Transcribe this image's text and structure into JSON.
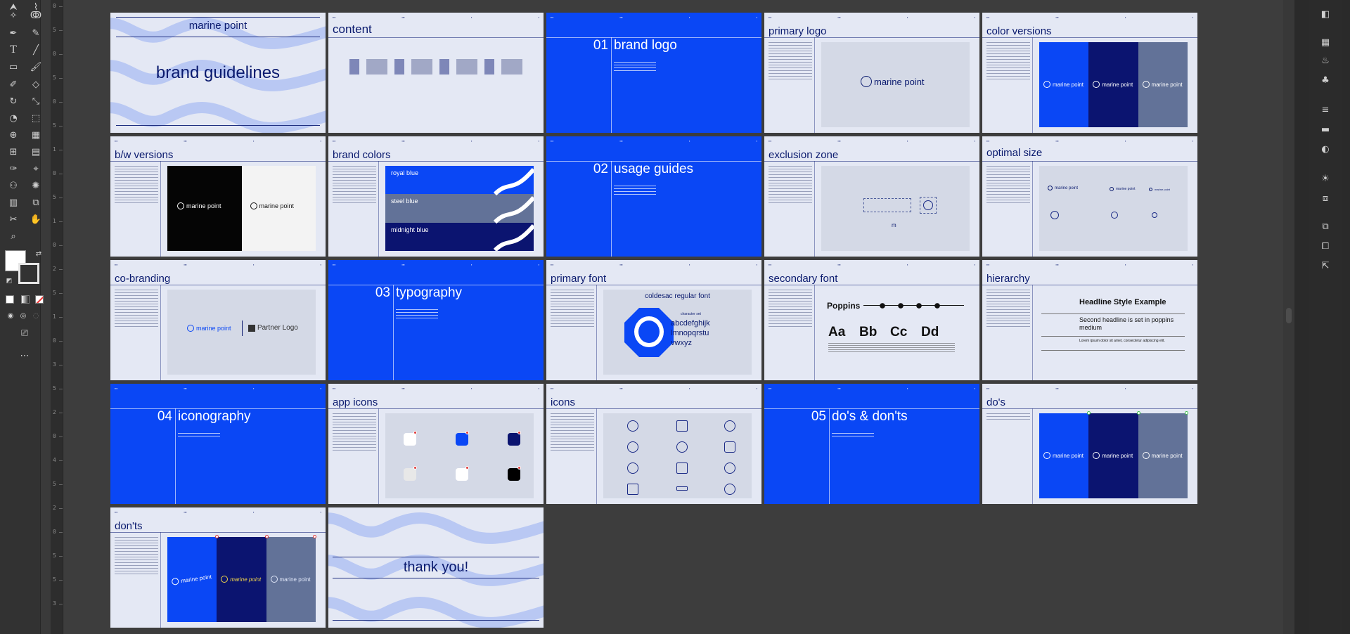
{
  "app": {
    "name": "Adobe Illustrator"
  },
  "tools": [
    "direct-selection",
    "lasso",
    "pen",
    "curvature",
    "type",
    "line",
    "rectangle",
    "paintbrush",
    "shaper",
    "eraser",
    "rotate",
    "scale",
    "warp",
    "free-transform",
    "shape-builder",
    "perspective-grid",
    "mesh",
    "gradient",
    "eyedropper",
    "blend",
    "symbol-sprayer",
    "column-graph",
    "artboard",
    "slice",
    "hand",
    "zoom"
  ],
  "ruler_labels": [
    "0",
    "5",
    "0",
    "5",
    "0",
    "5",
    "1",
    "0",
    "5",
    "1",
    "0",
    "2",
    "5",
    "1",
    "0",
    "3",
    "5",
    "2",
    "0",
    "4",
    "5",
    "2",
    "0",
    "5",
    "5",
    "3"
  ],
  "brand": "marine point",
  "slides": {
    "cover": {
      "title": "marine point",
      "subtitle": "brand guidelines"
    },
    "content": {
      "title": "content"
    },
    "s01": {
      "num": "01",
      "title": "brand logo"
    },
    "primary_logo": {
      "title": "primary logo",
      "logo": "marine point"
    },
    "color_versions": {
      "title": "color versions",
      "logo": "marine point"
    },
    "bw": {
      "title": "b/w versions",
      "logo": "marine point"
    },
    "brand_colors": {
      "title": "brand colors",
      "c1": "royal blue",
      "c2": "steel blue",
      "c3": "midnight blue"
    },
    "s02": {
      "num": "02",
      "title": "usage guides"
    },
    "exclusion": {
      "title": "exclusion zone",
      "m": "m"
    },
    "optimal": {
      "title": "optimal size",
      "logo": "marine point"
    },
    "cobranding": {
      "title": "co-branding",
      "logo": "marine point",
      "partner": "Partner Logo"
    },
    "s03": {
      "num": "03",
      "title": "typography"
    },
    "primary_font": {
      "title": "primary font",
      "font": "coldesac regular font",
      "charset_label": "character set",
      "l1": "abcdefghijk",
      "l2": "lmnopqrstu",
      "l3": "vwxyz"
    },
    "secondary_font": {
      "title": "secondary font",
      "font": "Poppins",
      "aa": "Aa",
      "bb": "Bb",
      "cc": "Cc",
      "dd": "Dd"
    },
    "hierarchy": {
      "title": "hierarchy",
      "h1": "Headline Style Example",
      "h2": "Second headline is set in poppins medium",
      "body": "Lorem ipsum dolor sit amet, consectetur adipiscing elit."
    },
    "s04": {
      "num": "04",
      "title": "iconography"
    },
    "app_icons": {
      "title": "app icons"
    },
    "icons": {
      "title": "icons"
    },
    "s05": {
      "num": "05",
      "title": "do's & don'ts"
    },
    "dos": {
      "title": "do's",
      "logo": "marine point"
    },
    "donts": {
      "title": "don'ts",
      "logo": "marine point"
    },
    "thanks": {
      "title": "thank you!"
    }
  },
  "colors": {
    "royal": "#0a47f5",
    "midnight": "#0b1470",
    "steel": "#627298",
    "light": "#e4e8f4",
    "ink": "#0a1a6e",
    "canvas": "#3d3d3d"
  }
}
